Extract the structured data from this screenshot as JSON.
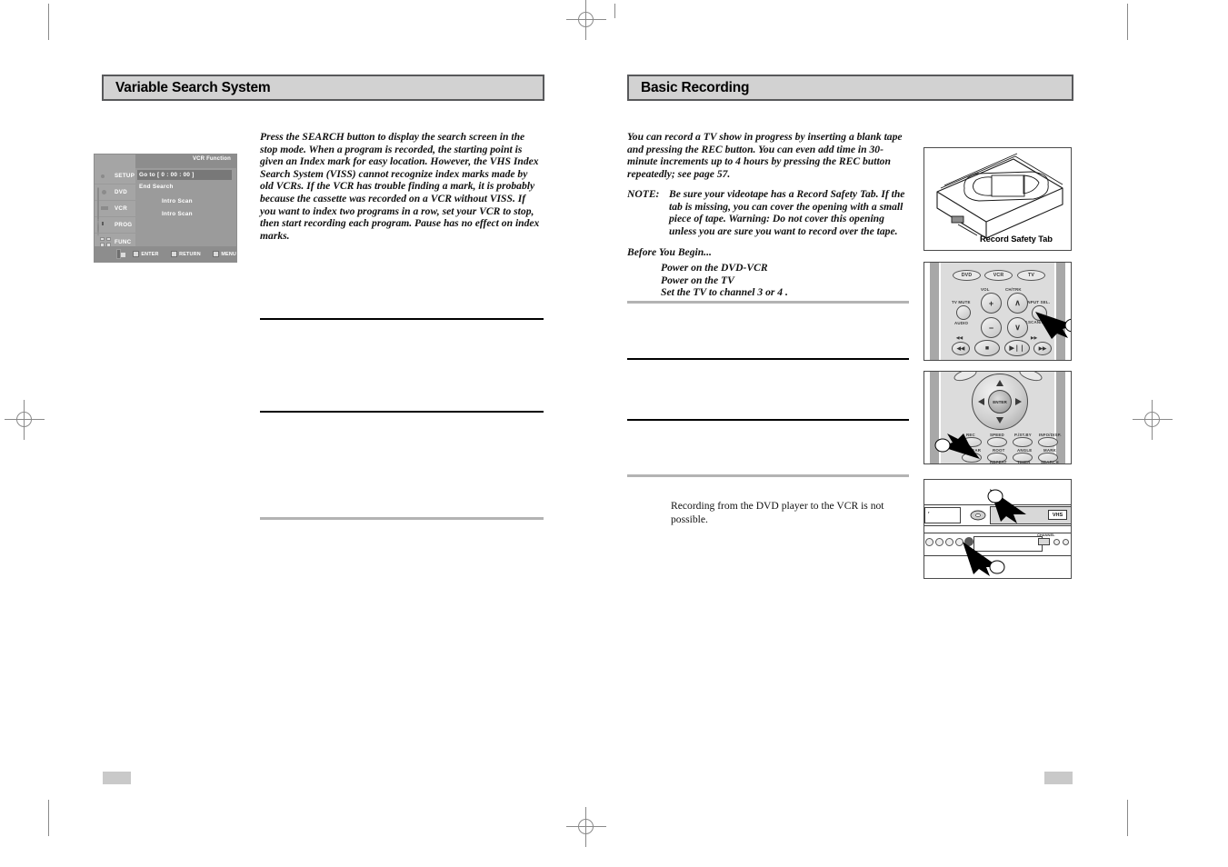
{
  "document": {
    "kind": "printed-manual-spread",
    "left_page": {
      "section_title": "Variable Search System",
      "body_paragraph": "Press the SEARCH button to display the search screen in the stop mode. When a program is recorded, the starting point is given an Index mark for easy location. However, the VHS Index Search System (VISS) cannot recognize index marks made by old VCRs. If the VCR has trouble finding a mark, it is probably because the cassette was recorded on a VCR without VISS. If you want to index two programs in a row, set your VCR to stop, then start recording each program. Pause has no effect on index marks.",
      "osd_screen": {
        "header_label": "VCR Function",
        "sidebar_items": [
          {
            "label": "SETUP",
            "icon": "gear-icon"
          },
          {
            "label": "DVD",
            "icon": "disc-icon"
          },
          {
            "label": "VCR",
            "icon": "vcr-icon"
          },
          {
            "label": "PROG",
            "icon": "clock-icon"
          },
          {
            "label": "FUNC",
            "icon": "function-grid-icon"
          }
        ],
        "menu_items": [
          {
            "label": "Go to [ 0 : 00 : 00 ]",
            "selected": true
          },
          {
            "label": "End Search",
            "selected": false
          },
          {
            "label": "Intro Scan",
            "selected": false,
            "indent": true
          },
          {
            "label": "Intro Scan",
            "selected": false,
            "indent": true
          }
        ],
        "footer_keys": [
          {
            "label": "ENTER",
            "icon": "enter-key-icon"
          },
          {
            "label": "RETURN",
            "icon": "return-key-icon"
          },
          {
            "label": "MENU",
            "icon": "menu-key-icon"
          }
        ],
        "nav_pad_icon": "direction-pad-icon"
      },
      "page_number": ""
    },
    "right_page": {
      "section_title": "Basic Recording",
      "body_paragraph": "You can record a TV show in progress by inserting a blank tape and pressing the REC button. You can even add time in 30-minute increments up to 4 hours by pressing the REC button repeatedly; see page 57.",
      "note": {
        "label": "NOTE:",
        "text": "Be sure your videotape has a Record Safety Tab. If the tab is missing, you can cover the opening with a small piece of tape. Warning: Do not cover this opening unless you are sure you want to record over the tape."
      },
      "before_you_begin": {
        "heading": "Before You Begin...",
        "steps": [
          "Power on the DVD-VCR",
          "Power on the TV",
          "Set the TV to channel 3 or 4 ."
        ]
      },
      "footnote": "Recording from the DVD player to the VCR is not possible.",
      "page_number": "",
      "figures": {
        "cassette": {
          "caption": "Record Safety Tab",
          "alt": "vhs-cassette-illustration"
        },
        "remote_top": {
          "alt": "remote-control-upper-section",
          "mode_buttons": [
            "DVD",
            "VCR",
            "TV"
          ],
          "labels": {
            "tv_mute": "TV MUTE",
            "audio": "AUDIO",
            "vol": "VOL",
            "ch_trk": "CH/TRK",
            "input_sel": "INPUT SEL.",
            "pscan_skip": "P.SCAN/SKIP",
            "vol_plus": "+",
            "vol_minus": "−",
            "ch_up": "∧",
            "ch_down": "∨"
          },
          "transport": [
            "◀◀",
            "■",
            "▶❘❘",
            "▶▶"
          ],
          "transport_marks": [
            "◀◀",
            "▶▶"
          ],
          "callout_target": "INPUT SEL."
        },
        "remote_bottom": {
          "alt": "remote-control-lower-section",
          "center_label": "ENTER",
          "row1": [
            "REC",
            "SPEED",
            "P./ST.BY",
            "INFO/DISP."
          ],
          "row2": [
            "CLEAR",
            "ROOT",
            "ANGLE",
            "MARK"
          ],
          "row2_sub": [
            "REPEAT",
            "TIMER",
            "SEARCH"
          ],
          "callout_target": "REC"
        },
        "front_panel": {
          "alt": "dvd-vcr-front-panel",
          "vhs_label": "VHS",
          "callout_targets": [
            "cassette-slot",
            "rec-button"
          ]
        }
      }
    }
  }
}
